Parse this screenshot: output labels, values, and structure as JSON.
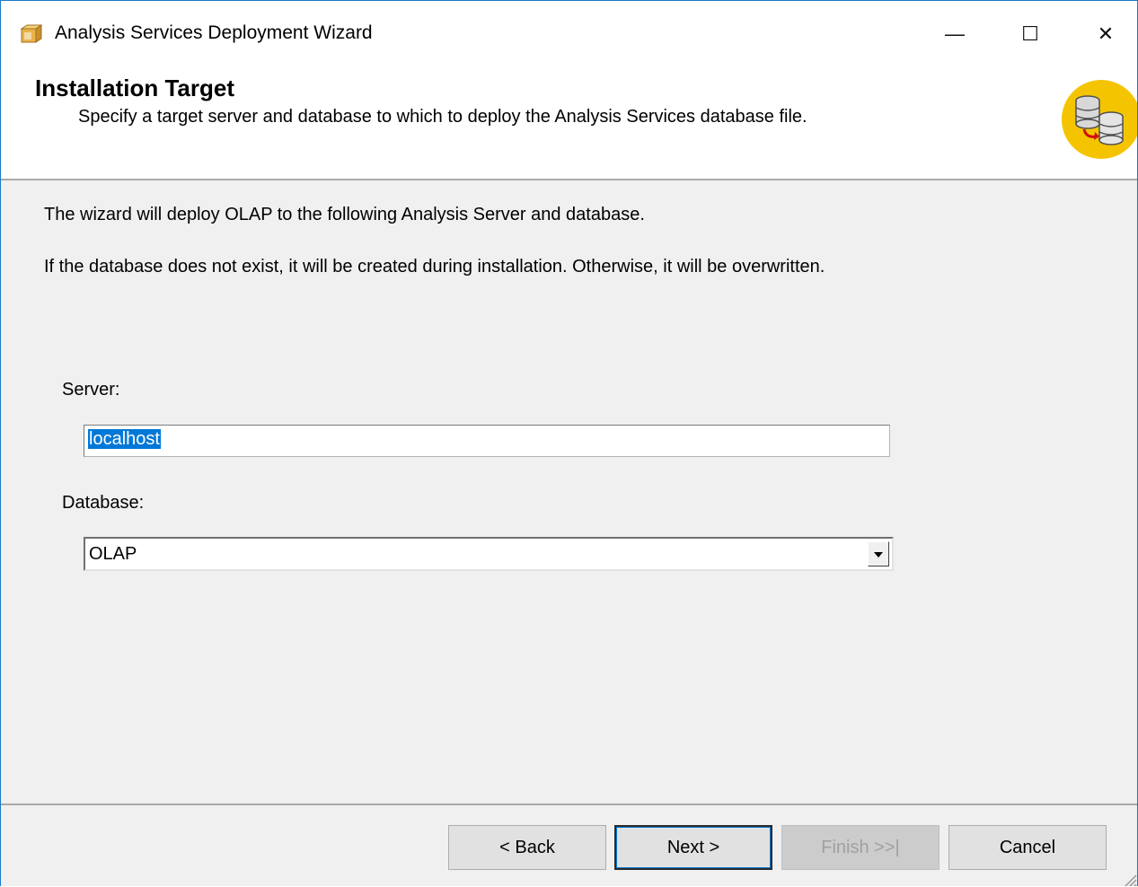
{
  "window": {
    "title": "Analysis Services Deployment Wizard",
    "controls": {
      "minimize": "—",
      "maximize": "☐",
      "close": "✕"
    }
  },
  "header": {
    "title": "Installation Target",
    "subtitle": "Specify a target server and database to which to deploy the Analysis Services database file.",
    "icon": "database-deploy-icon"
  },
  "body": {
    "info_line_1": "The wizard will deploy OLAP to the following Analysis Server and database.",
    "info_line_2": "If the database does not exist, it will be created during installation. Otherwise, it will be overwritten.",
    "server": {
      "label": "Server:",
      "value": "localhost"
    },
    "database": {
      "label": "Database:",
      "value": "OLAP"
    }
  },
  "footer": {
    "back": "< Back",
    "next": "Next >",
    "finish": "Finish >>|",
    "cancel": "Cancel"
  },
  "colors": {
    "accent": "#0078d7",
    "window_border": "#1979ca",
    "icon_yellow": "#f5c400"
  }
}
